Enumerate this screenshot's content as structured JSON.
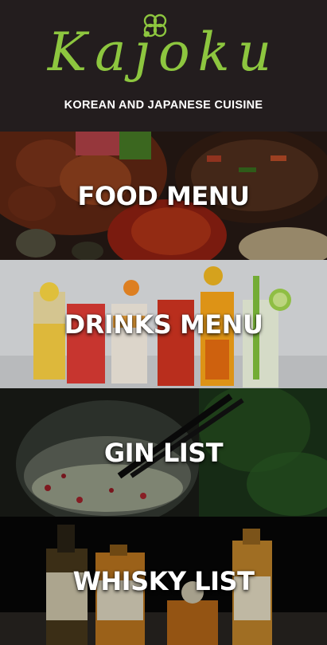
{
  "brand": {
    "name": "Kajoku",
    "tagline": "KOREAN AND JAPANESE CUISINE",
    "accent_color": "#8dc63f",
    "logo_icon": "clover-flower-icon"
  },
  "menu_tiles": [
    {
      "label": "FOOD MENU",
      "image": "korean-food-photo"
    },
    {
      "label": "DRINKS MENU",
      "image": "cocktail-glasses-photo"
    },
    {
      "label": "GIN LIST",
      "image": "gin-glass-photo"
    },
    {
      "label": "WHISKY LIST",
      "image": "whisky-bottles-photo"
    }
  ]
}
